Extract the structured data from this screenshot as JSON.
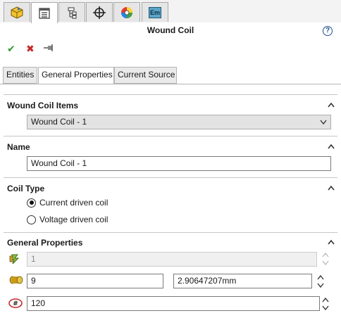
{
  "manager_tabs": [
    {
      "name": "featuremanager-tab",
      "icon": "part-cube-icon",
      "active": false
    },
    {
      "name": "propertymanager-tab",
      "icon": "property-list-icon",
      "active": true
    },
    {
      "name": "configurationmanager-tab",
      "icon": "configuration-tree-icon",
      "active": false
    },
    {
      "name": "dimxpert-tab",
      "icon": "crosshair-icon",
      "active": false
    },
    {
      "name": "display-manager-tab",
      "icon": "color-wheel-icon",
      "active": false
    },
    {
      "name": "em-tab",
      "icon": "em-icon",
      "label": "Em",
      "active": false
    }
  ],
  "title": "Wound Coil",
  "help": "?",
  "actions": {
    "ok": "✔",
    "cancel": "✖",
    "pin": "⊣"
  },
  "tabs": [
    {
      "label": "Entities",
      "active": false
    },
    {
      "label": "General Properties",
      "active": true
    },
    {
      "label": "Current Source",
      "active": false
    }
  ],
  "sections": {
    "items": {
      "title": "Wound Coil Items",
      "selected": "Wound Coil - 1"
    },
    "name": {
      "title": "Name",
      "value": "Wound Coil - 1"
    },
    "coil_type": {
      "title": "Coil Type",
      "options": [
        {
          "label": "Current driven coil",
          "checked": true
        },
        {
          "label": "Voltage driven coil",
          "checked": false
        }
      ]
    },
    "general": {
      "title": "General Properties",
      "field1": "1",
      "wire_gauge": "9",
      "wire_diameter": "2.90647207mm",
      "turns": "120"
    }
  },
  "colors": {
    "accent": "#1f4e8c",
    "ok": "#2c9c2c",
    "cancel": "#c62828"
  }
}
